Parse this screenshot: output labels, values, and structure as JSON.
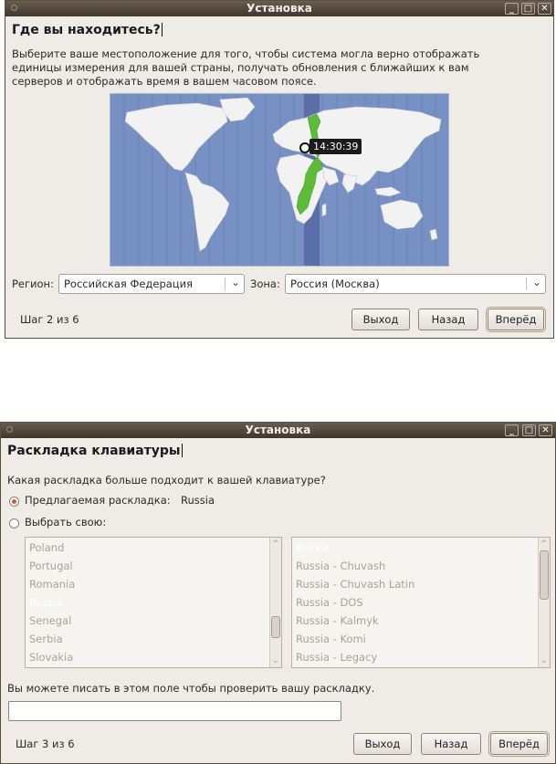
{
  "window1": {
    "title": "Установка",
    "heading": "Где вы находитесь?",
    "description_lines": [
      "Выберите ваше местоположение для того, чтобы система могла верно отображать",
      "единицы измерения для вашей страны, получать обновления с ближайших к вам",
      "серверов и отображать время в вашем часовом поясе."
    ],
    "map_time": "14:30:39",
    "region_label": "Регион:",
    "region_value": "Российская Федерация",
    "zone_label": "Зона:",
    "zone_value": "Россия (Москва)",
    "step": "Шаг 2 из 6",
    "buttons": {
      "quit": "Выход",
      "back": "Назад",
      "forward": "Вперёд"
    }
  },
  "window2": {
    "title": "Установка",
    "heading": "Раскладка клавиатуры",
    "question": "Какая раскладка больше подходит к вашей клавиатуре?",
    "suggested_label": "Предлагаемая раскладка:",
    "suggested_value": "Russia",
    "choose_label": "Выбрать свою:",
    "countries": [
      "Poland",
      "Portugal",
      "Romania",
      "Russia",
      "Senegal",
      "Serbia",
      "Slovakia"
    ],
    "variants": [
      "Russia",
      "Russia - Chuvash",
      "Russia - Chuvash Latin",
      "Russia - DOS",
      "Russia - Kalmyk",
      "Russia - Komi",
      "Russia - Legacy"
    ],
    "test_hint": "Вы можете писать в этом поле чтобы проверить вашу раскладку.",
    "test_value": "",
    "step": "Шаг 3 из 6",
    "buttons": {
      "quit": "Выход",
      "back": "Назад",
      "forward": "Вперёд"
    }
  },
  "colors": {
    "titlebar": "#4f4439",
    "window_bg": "#efebe6",
    "map_ocean": "#7891c4",
    "map_land": "#f2f2f2",
    "timezone_band": "#5a6ea8",
    "selected_country": "#5dbb3a",
    "radio_accent": "#d45a1f"
  }
}
